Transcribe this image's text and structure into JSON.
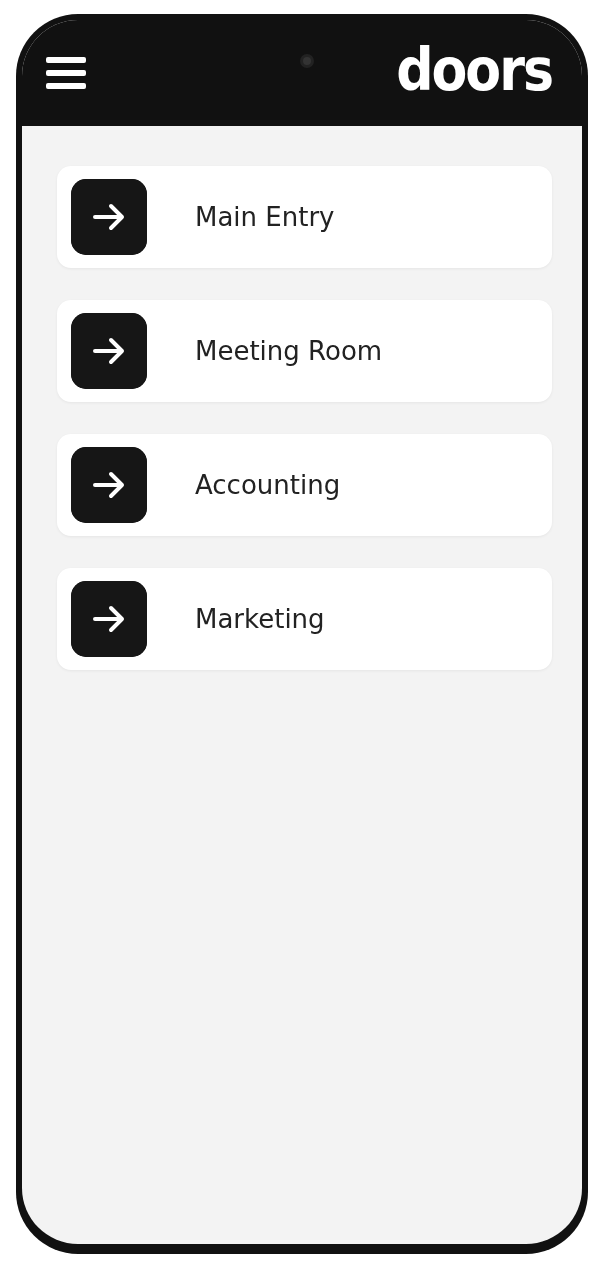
{
  "app_bar": {
    "logo": "doors"
  },
  "doors": [
    {
      "name": "Main Entry"
    },
    {
      "name": "Meeting Room"
    },
    {
      "name": "Accounting"
    },
    {
      "name": "Marketing"
    }
  ]
}
